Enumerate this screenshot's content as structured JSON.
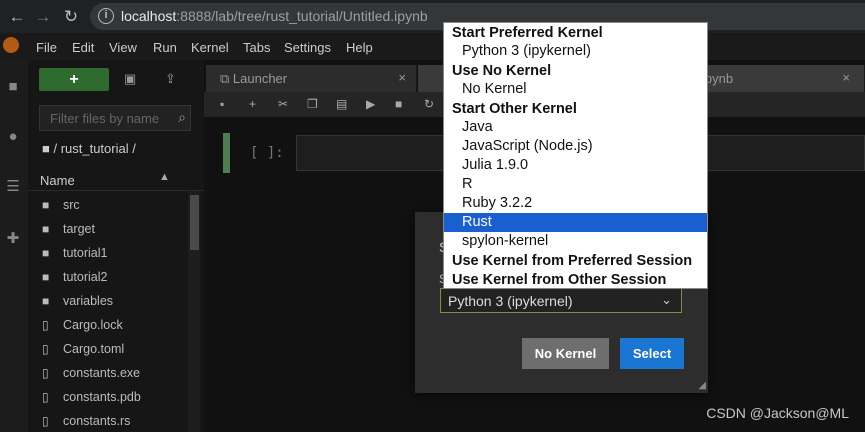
{
  "browser": {
    "back": "←",
    "forward": "→",
    "reload": "↻",
    "url_host": "localhost",
    "url_rest": ":8888/lab/tree/rust_tutorial/Untitled.ipynb"
  },
  "menu": [
    "File",
    "Edit",
    "View",
    "Run",
    "Kernel",
    "Tabs",
    "Settings",
    "Help"
  ],
  "filebrowser": {
    "new_label": "+",
    "filter_placeholder": "Filter files by name",
    "breadcrumb": "/ rust_tutorial /",
    "column_name": "Name",
    "items": [
      {
        "type": "folder",
        "name": "src"
      },
      {
        "type": "folder",
        "name": "target"
      },
      {
        "type": "folder",
        "name": "tutorial1"
      },
      {
        "type": "folder",
        "name": "tutorial2"
      },
      {
        "type": "folder",
        "name": "variables"
      },
      {
        "type": "file",
        "name": "Cargo.lock"
      },
      {
        "type": "file",
        "name": "Cargo.toml"
      },
      {
        "type": "file",
        "name": "constants.exe"
      },
      {
        "type": "file",
        "name": "constants.pdb"
      },
      {
        "type": "file",
        "name": "constants.rs"
      }
    ]
  },
  "tabs": [
    {
      "label": "Launcher",
      "close": "×"
    },
    {
      "label": "ipynb",
      "close": "×"
    }
  ],
  "cell": {
    "prompt": "[ ]:"
  },
  "dialog": {
    "current_kernel": "Python 3 (ipykernel)",
    "no_kernel_label": "No Kernel",
    "select_label": "Select"
  },
  "dropdown": {
    "groups": [
      {
        "label": "Start Preferred Kernel",
        "options": [
          "Python 3 (ipykernel)"
        ]
      },
      {
        "label": "Use No Kernel",
        "options": [
          "No Kernel"
        ]
      },
      {
        "label": "Start Other Kernel",
        "options": [
          "Java",
          "JavaScript (Node.js)",
          "Julia 1.9.0",
          "R",
          "Ruby 3.2.2",
          "Rust",
          "spylon-kernel"
        ]
      },
      {
        "label": "Use Kernel from Preferred Session",
        "options": []
      },
      {
        "label": "Use Kernel from Other Session",
        "options": []
      }
    ],
    "selected": "Rust"
  },
  "watermark": "CSDN @Jackson@ML",
  "colors": {
    "accent": "#1976d2",
    "highlight": "#1a5fd0",
    "new_button": "#2f6b2f"
  }
}
